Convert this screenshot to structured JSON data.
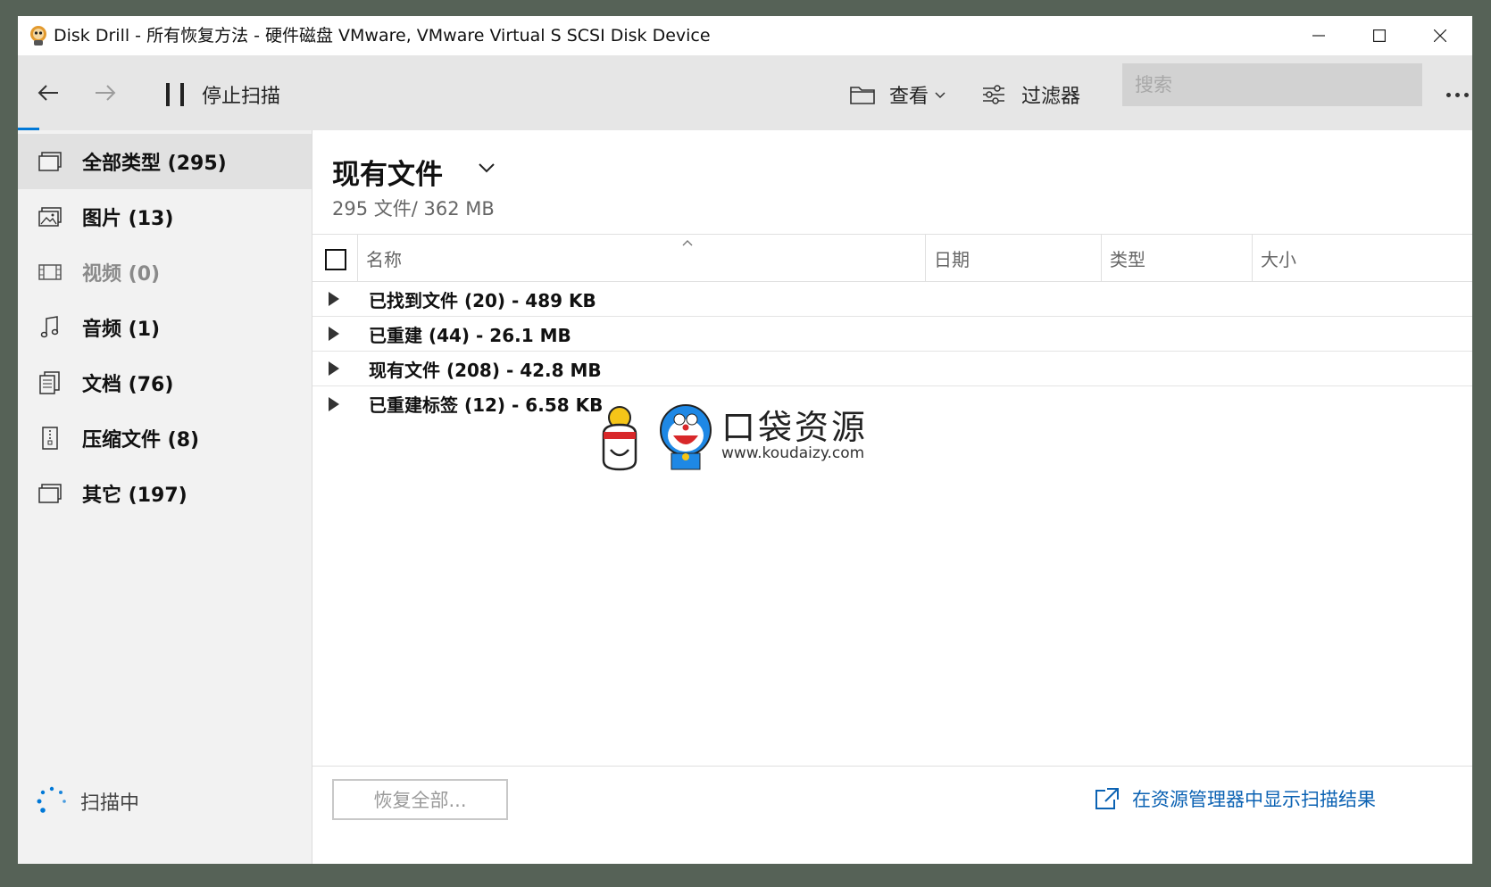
{
  "window": {
    "title": "Disk Drill - 所有恢复方法 - 硬件磁盘 VMware, VMware Virtual S SCSI Disk Device"
  },
  "toolbar": {
    "pause_label": "停止扫描",
    "view_label": "查看",
    "filter_label": "过滤器",
    "search_placeholder": "搜索"
  },
  "sidebar": {
    "items": [
      {
        "label": "全部类型 (295)",
        "icon": "all-types-icon",
        "active": true
      },
      {
        "label": "图片 (13)",
        "icon": "picture-icon"
      },
      {
        "label": "视频 (0)",
        "icon": "video-icon",
        "disabled": true
      },
      {
        "label": "音频 (1)",
        "icon": "music-icon"
      },
      {
        "label": "文档 (76)",
        "icon": "document-icon"
      },
      {
        "label": "压缩文件 (8)",
        "icon": "archive-icon"
      },
      {
        "label": "其它 (197)",
        "icon": "other-icon"
      }
    ],
    "status": "扫描中"
  },
  "main": {
    "heading": "现有文件",
    "summary": "295 文件/ 362 MB",
    "columns": [
      "名称",
      "日期",
      "类型",
      "大小"
    ],
    "rows": [
      "已找到文件 (20) - 489 KB",
      "已重建 (44) - 26.1 MB",
      "现有文件 (208) - 42.8 MB",
      "已重建标签 (12) - 6.58 KB"
    ],
    "restore_label": "恢复全部...",
    "explorer_link": "在资源管理器中显示扫描结果"
  },
  "watermark": {
    "text": "口袋资源",
    "url": "www.koudaizy.com"
  },
  "colors": {
    "accent": "#0078d7",
    "link": "#0b62b3",
    "desktop": "#566257"
  }
}
